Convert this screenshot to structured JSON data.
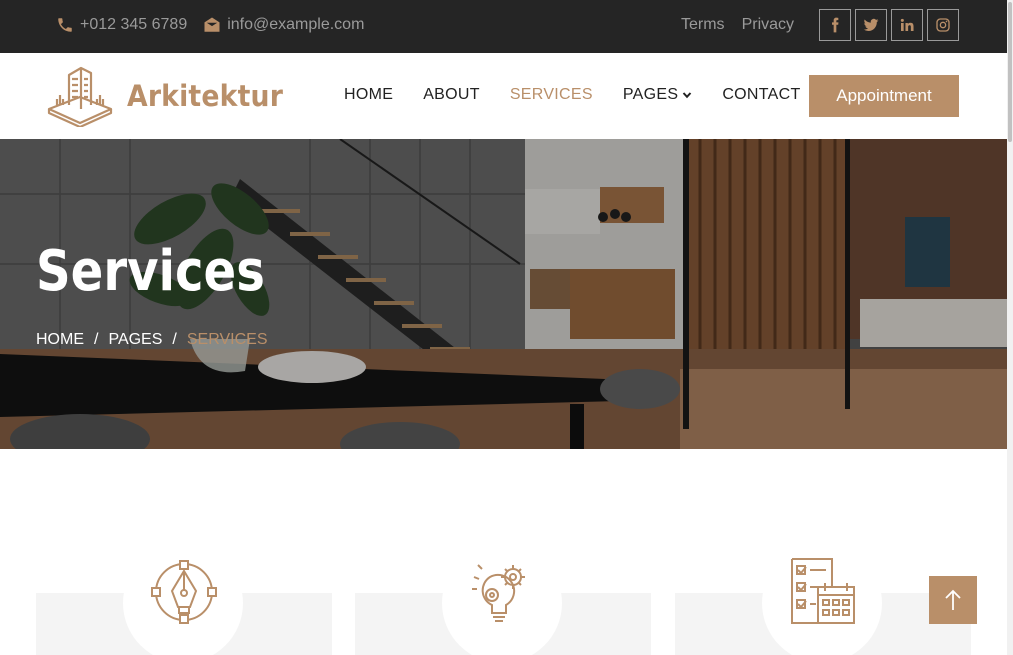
{
  "topbar": {
    "phone": "+012 345 6789",
    "email": "info@example.com",
    "links": [
      "Terms",
      "Privacy"
    ],
    "socials": [
      "facebook-icon",
      "twitter-icon",
      "linkedin-icon",
      "instagram-icon"
    ],
    "background": "#252525"
  },
  "navbar": {
    "brand": "Arkitektur",
    "menu": [
      "HOME",
      "ABOUT",
      "SERVICES",
      "PAGES",
      "CONTACT"
    ],
    "active_item": "SERVICES",
    "cta": "Appointment"
  },
  "hero": {
    "title": "Services",
    "breadcrumb": [
      "HOME",
      "PAGES",
      "SERVICES"
    ],
    "separator": "/"
  },
  "services": {
    "icons": [
      "pen-tool-icon",
      "idea-gears-icon",
      "checklist-calendar-icon"
    ]
  },
  "colors": {
    "accent": "#b98f69",
    "dark": "#252525",
    "card_bg": "#f4f4f4"
  }
}
